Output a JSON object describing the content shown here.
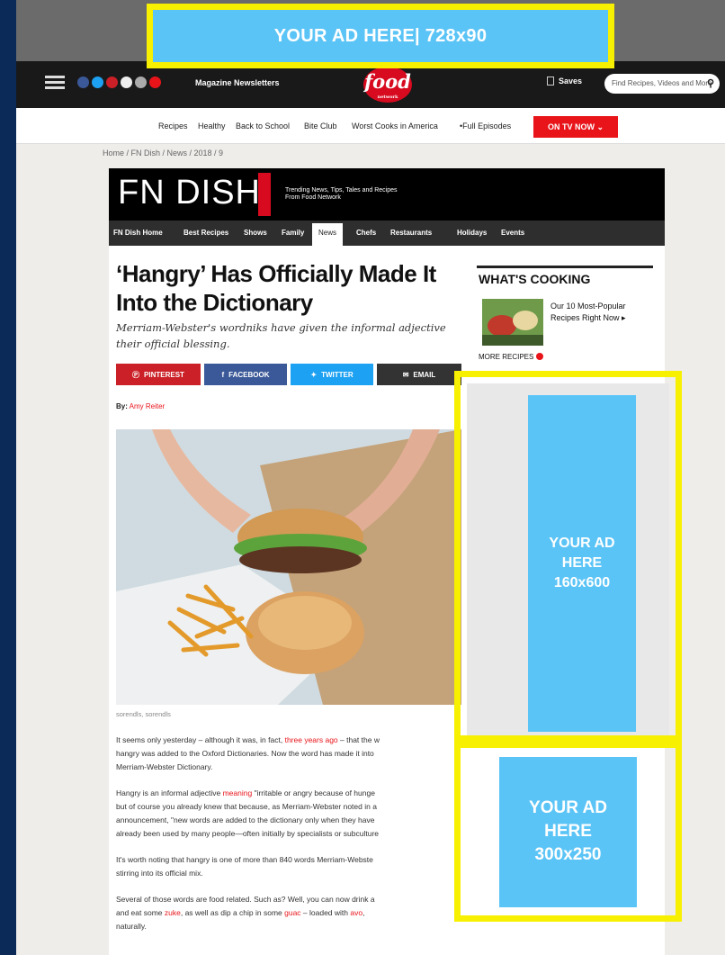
{
  "ads": {
    "leaderboard": "YOUR AD HERE| 728x90",
    "skyscraper": [
      "YOUR AD",
      "HERE",
      "160x600"
    ],
    "rectangle": [
      "YOUR AD",
      "HERE",
      "300x250"
    ]
  },
  "header": {
    "magazine": "Magazine",
    "newsletters": "Newsletters",
    "logo": "food",
    "logo_sub": "network",
    "saves": "Saves",
    "search_placeholder": "Find Recipes, Videos and More"
  },
  "nav": {
    "items": [
      "Recipes",
      "Healthy",
      "Back to School",
      "Bite Club",
      "Worst Cooks in America",
      "•Full Episodes"
    ],
    "on_tv": "ON TV NOW"
  },
  "breadcrumb": "Home / FN Dish / News / 2018 / 9",
  "dish": {
    "title": "FN DISH",
    "tagline": [
      "Trending News, Tips, Tales and Recipes",
      "From Food Network"
    ],
    "subnav": [
      "FN Dish Home",
      "Best Recipes",
      "Shows",
      "Family",
      "News",
      "Chefs",
      "Restaurants",
      "Holidays",
      "Events"
    ]
  },
  "article": {
    "headline": "‘Hangry’ Has Officially Made It Into the Dictionary",
    "dek": "Merriam-Webster's wordniks have given the informal adjective their official blessing.",
    "share": [
      "PINTEREST",
      "FACEBOOK",
      "TWITTER",
      "EMAIL"
    ],
    "byline_label": "By:",
    "author": "Amy Reiter",
    "caption": "sorendls, sorendls",
    "paragraphs": [
      [
        "It seems only yesterday – although it was, in fact, ",
        "three years ago",
        " – that the w"
      ],
      [
        "hangry was added to the Oxford Dictionaries. Now the word has made it into"
      ],
      [
        "Merriam-Webster Dictionary."
      ],
      [
        "Hangry is an informal adjective ",
        "meaning",
        " \"irritable or angry because of hunge"
      ],
      [
        "but of course you already knew that because, as Merriam-Webster noted in a"
      ],
      [
        "announcement, \"new words are added to the dictionary only when they have"
      ],
      [
        "already been used by many people—often initially by specialists or subculture"
      ],
      [
        "It's worth noting that hangry is one of more than 840 words Merriam-Webste"
      ],
      [
        "stirring into its official mix."
      ],
      [
        "Several of those words are food related. Such as? Well, you can now drink a "
      ],
      [
        "and eat some ",
        "zuke",
        ", as well as dip a chip in some ",
        "guac",
        " – loaded with ",
        "avo",
        ","
      ],
      [
        "naturally."
      ]
    ]
  },
  "sidebar": {
    "title": "WHAT'S COOKING",
    "item": "Our 10 Most-Popular Recipes Right Now",
    "more": "MORE RECIPES"
  },
  "colors": {
    "outer_bg": "#0b2a57",
    "ad_fill": "#5bc4f6",
    "ad_border": "#f7f000",
    "brand_red": "#d70a1f",
    "pinterest": "#cb2027",
    "facebook": "#3b5998",
    "twitter": "#1da1f2",
    "email": "#333333"
  }
}
